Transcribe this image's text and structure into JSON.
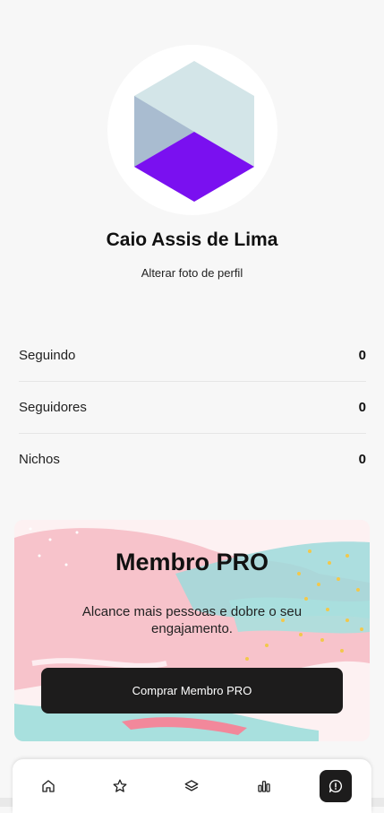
{
  "profile": {
    "name": "Caio Assis de Lima",
    "change_photo_label": "Alterar foto de perfil"
  },
  "stats": [
    {
      "label": "Seguindo",
      "value": "0"
    },
    {
      "label": "Seguidores",
      "value": "0"
    },
    {
      "label": "Nichos",
      "value": "0"
    }
  ],
  "promo": {
    "title": "Membro PRO",
    "description": "Alcance mais pessoas e dobre o seu engajamento.",
    "button_label": "Comprar Membro PRO"
  },
  "bottom_nav": {
    "items": [
      {
        "icon": "home-icon",
        "active": false
      },
      {
        "icon": "star-icon",
        "active": false
      },
      {
        "icon": "layers-icon",
        "active": false
      },
      {
        "icon": "bar-chart-icon",
        "active": false
      },
      {
        "icon": "chat-alert-icon",
        "active": true
      }
    ]
  },
  "colors": {
    "accent_purple": "#7a10f0",
    "hex_light": "#d3e5e8",
    "hex_mid": "#a9bcd0",
    "dark_button": "#1d1c1c"
  }
}
